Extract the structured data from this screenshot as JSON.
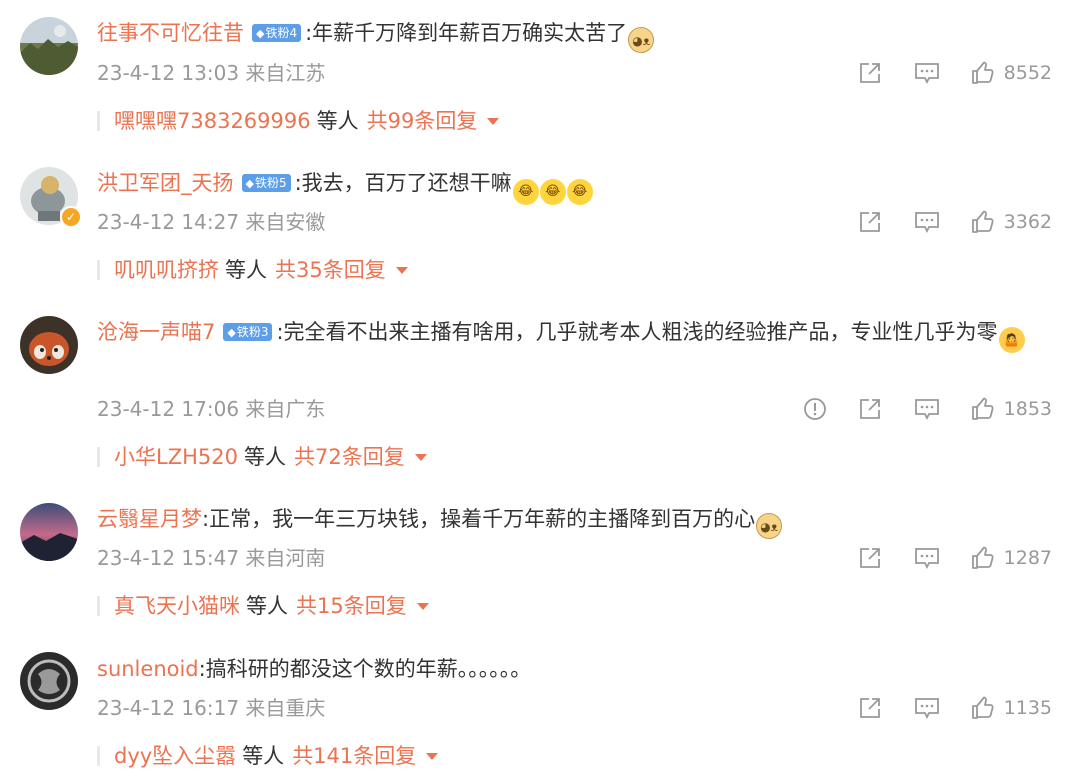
{
  "comments": [
    {
      "user": "往事不可忆往昔",
      "fan_label": "铁粉4",
      "text": ":年薪千万降到年薪百万确实太苦了",
      "time": "23-4-12 13:03",
      "location": "来自江苏",
      "likes": "8552",
      "reply_user": "嘿嘿嘿7383269996",
      "reply_etc": "等人",
      "reply_total": "共99条回复"
    },
    {
      "user": "洪卫军团_天扬",
      "fan_label": "铁粉5",
      "text": ":我去，百万了还想干嘛",
      "time": "23-4-12 14:27",
      "location": "来自安徽",
      "likes": "3362",
      "reply_user": "叽叽叽挤挤",
      "reply_etc": "等人",
      "reply_total": "共35条回复"
    },
    {
      "user": "沧海一声喵7",
      "fan_label": "铁粉3",
      "text": ":完全看不出来主播有啥用，几乎就考本人粗浅的经验推产品，专业性几乎为零",
      "time": "23-4-12 17:06",
      "location": "来自广东",
      "likes": "1853",
      "reply_user": "小华LZH520",
      "reply_etc": "等人",
      "reply_total": "共72条回复"
    },
    {
      "user": "云翳星月梦",
      "text": ":正常，我一年三万块钱，操着千万年薪的主播降到百万的心",
      "time": "23-4-12 15:47",
      "location": "来自河南",
      "likes": "1287",
      "reply_user": "真飞天小猫咪",
      "reply_etc": "等人",
      "reply_total": "共15条回复"
    },
    {
      "user": "sunlenoid",
      "text": ":搞科研的都没这个数的年薪。。。。。。",
      "time": "23-4-12 16:17",
      "location": "来自重庆",
      "likes": "1135",
      "reply_user": "dyy坠入尘嚣",
      "reply_etc": "等人",
      "reply_total": "共141条回复"
    }
  ],
  "icons": {
    "share": "share-icon",
    "comment": "comment-icon",
    "like": "thumbs-up-icon",
    "report": "report-icon",
    "dropdown": "caret-down-icon"
  },
  "colors": {
    "username": "#eb7350",
    "meta": "#999999",
    "fan_badge": "#5d9ee8",
    "verified": "#f5a623"
  }
}
